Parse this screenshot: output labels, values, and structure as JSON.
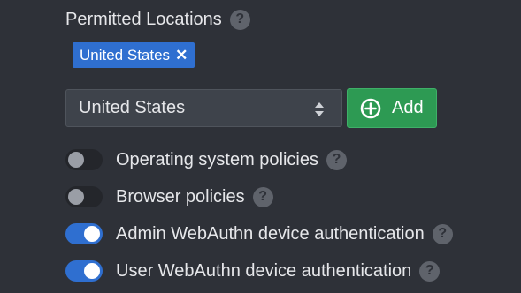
{
  "permitted_locations": {
    "title": "Permitted Locations",
    "help": "?",
    "selected_tags": [
      {
        "label": "United States",
        "remove_glyph": "✕"
      }
    ],
    "select": {
      "value": "United States",
      "icon": "chevron-updown-icon"
    },
    "add_button": {
      "label": "Add",
      "icon": "plus-circle-icon"
    }
  },
  "policies": [
    {
      "label": "Operating system policies",
      "enabled": false,
      "help": "?"
    },
    {
      "label": "Browser policies",
      "enabled": false,
      "help": "?"
    },
    {
      "label": "Admin WebAuthn device authentication",
      "enabled": true,
      "help": "?"
    },
    {
      "label": "User WebAuthn device authentication",
      "enabled": true,
      "help": "?"
    }
  ],
  "colors": {
    "background": "#2e3138",
    "accent_blue": "#2f6fd0",
    "add_green": "#2d9a53",
    "help_grey": "#5f636b"
  }
}
